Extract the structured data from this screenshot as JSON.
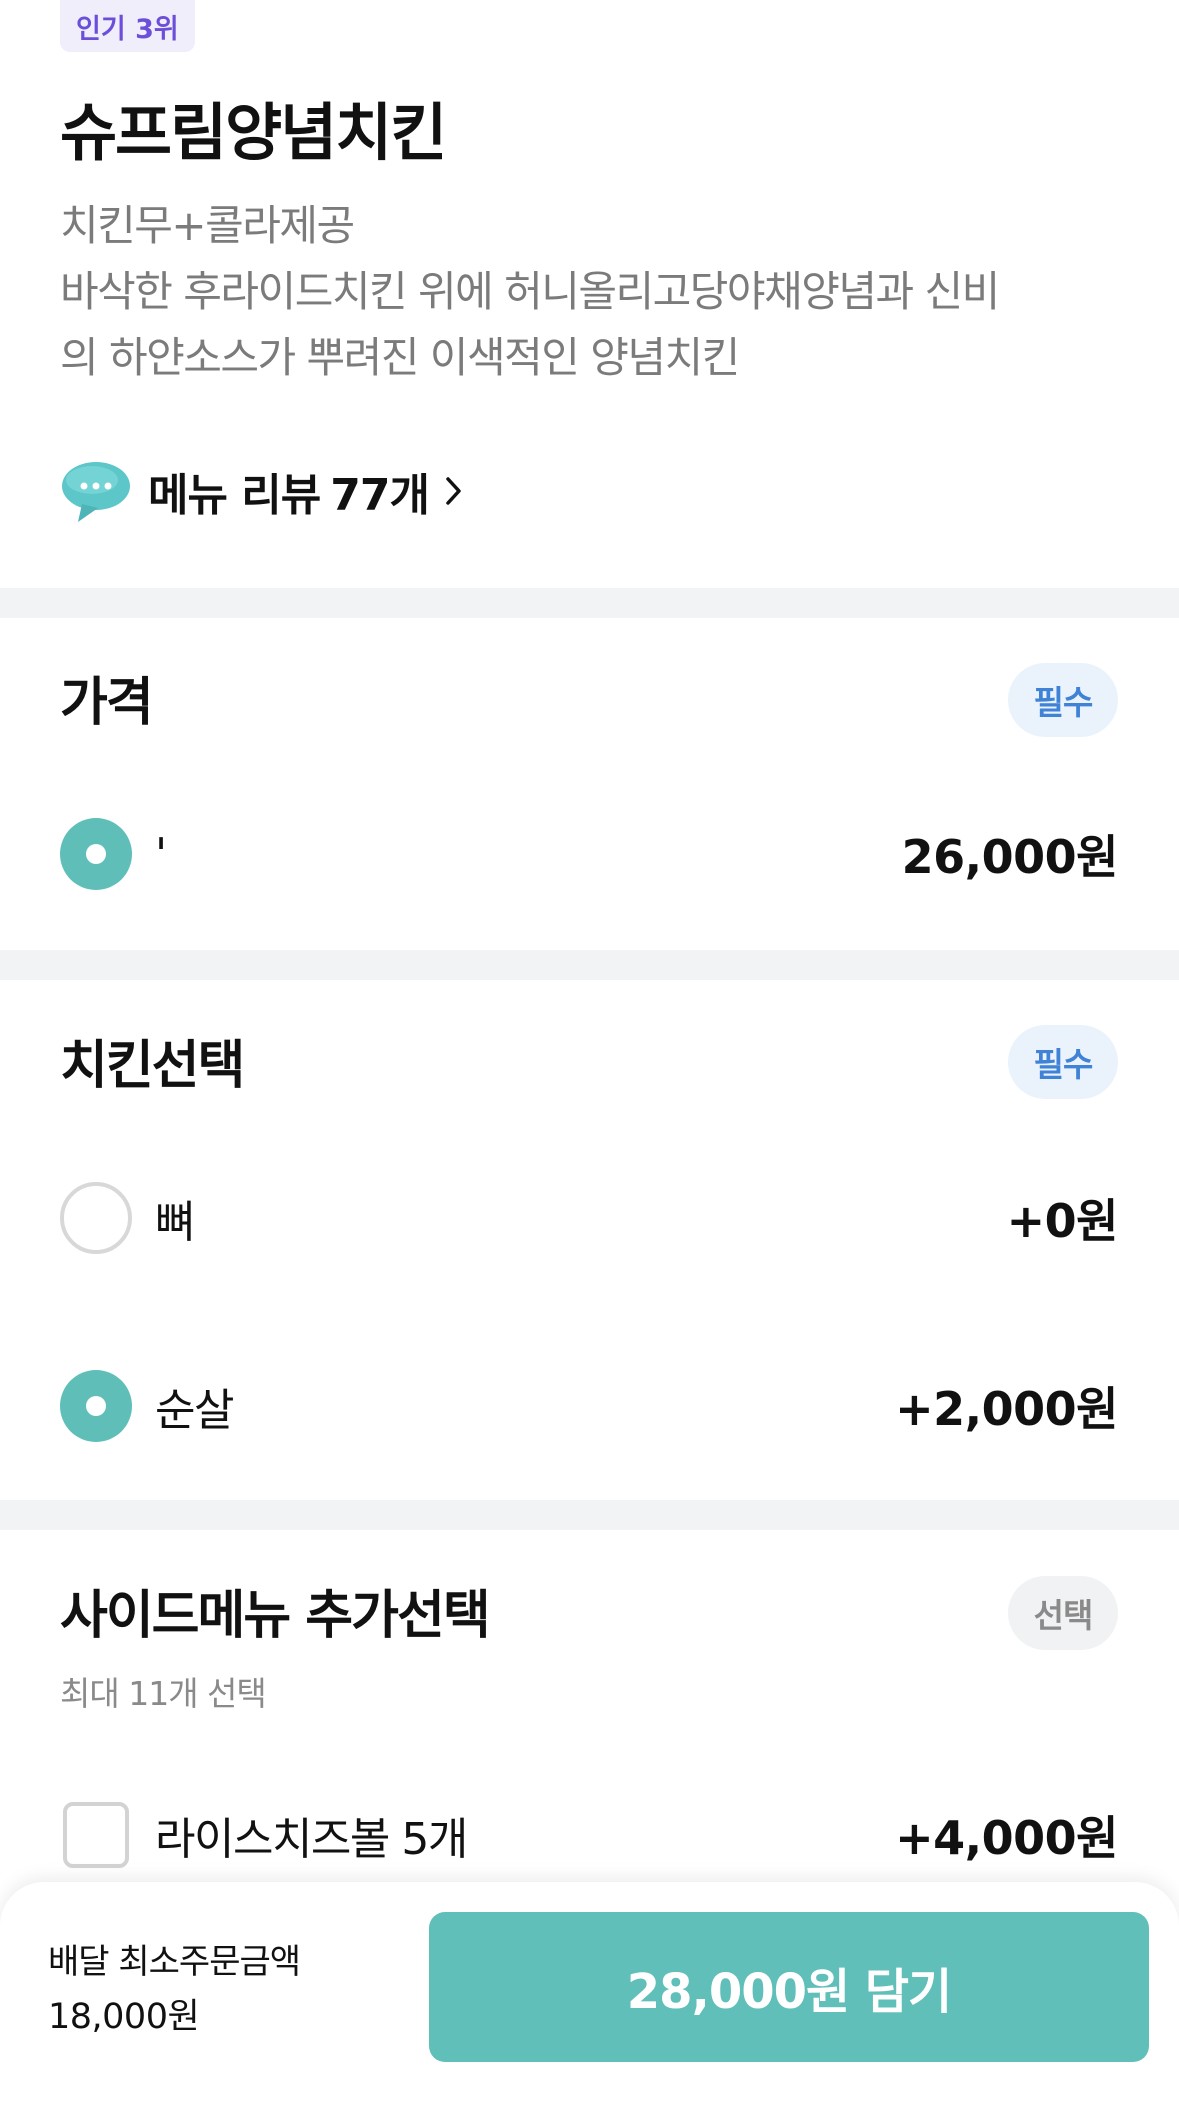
{
  "header": {
    "rank_badge": "인기 3위",
    "title": "슈프림양념치킨",
    "description_lines": [
      "치킨무+콜라제공",
      "바삭한 후라이드치킨 위에 허니올리고당야채양념과 신비",
      "의 하얀소스가 뿌려진 이색적인 양념치킨"
    ],
    "review_label": "메뉴 리뷰",
    "review_count": "77개"
  },
  "groups": [
    {
      "title": "가격",
      "badge": "필수",
      "options": [
        {
          "label": "'",
          "price": "26,000원",
          "selected": true
        }
      ]
    },
    {
      "title": "치킨선택",
      "badge": "필수",
      "options": [
        {
          "label": "뼈",
          "price": "+0원",
          "selected": false
        },
        {
          "label": "순살",
          "price": "+2,000원",
          "selected": true
        }
      ]
    },
    {
      "title": "사이드메뉴 추가선택",
      "badge": "선택",
      "subtitle": "최대 11개 선택",
      "options": [
        {
          "label": "라이스치즈볼 5개",
          "price": "+4,000원",
          "selected": false
        }
      ]
    }
  ],
  "bottom_bar": {
    "min_order_label": "배달 최소주문금액",
    "min_order_value": "18,000원",
    "cart_button_label": "28,000원 담기"
  },
  "colors": {
    "accent": "#61bfb9",
    "rank_text": "#6b4fd8",
    "required_badge_text": "#3f82d6",
    "divider": "#f2f3f5"
  },
  "icons": {
    "review": "speech-bubble-icon",
    "chevron": "chevron-right-icon"
  }
}
